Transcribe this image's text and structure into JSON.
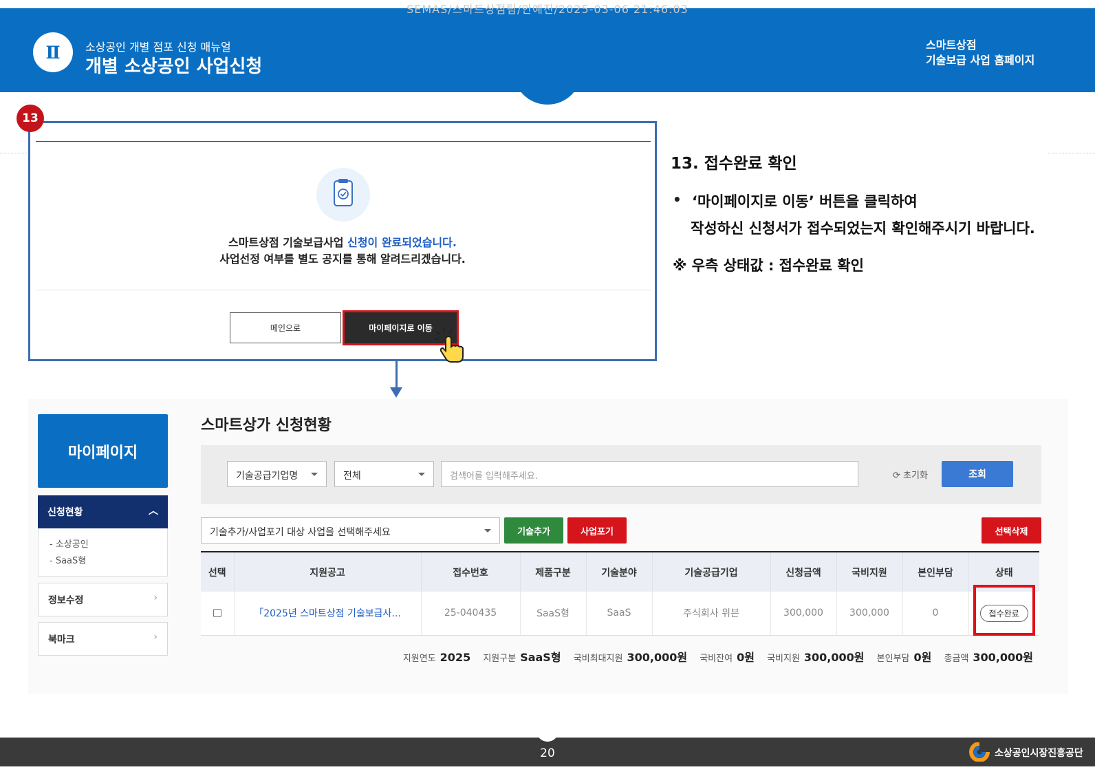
{
  "watermark": "SEMAS/스마트상점팀/안예진/2025-03-06 21:46:03",
  "header": {
    "chapter": "Ⅱ",
    "subtitle": "소상공인 개별 점포 신청 매뉴얼",
    "title": "개별 소상공인 사업신청",
    "right_line1": "스마트상점",
    "right_line2": "기술보급 사업 홈페이지"
  },
  "step_number": "13",
  "modal": {
    "message_line1_prefix": "스마트상점 기술보급사업 ",
    "message_line1_highlight": "신청이 완료되었습니다.",
    "message_line2": "사업선정 여부를 별도 공지를 통해 알려드리겠습니다.",
    "btn_main": "메인으로",
    "btn_mypage": "마이페이지로 이동",
    "icon": "clipboard-check-icon"
  },
  "instructions": {
    "title": "13. 접수완료 확인",
    "bullet": "•",
    "line1": "‘마이페이지로 이동’ 버튼을 클릭하여",
    "line2": "작성하신 신청서가 접수되었는지 확인해주시기 바랍니다.",
    "note": "※ 우측 상태값 : 접수완료 확인"
  },
  "sidebar": {
    "title": "마이페이지",
    "active_menu": "신청현황",
    "sub_items": [
      "- 소상공인",
      "- SaaS형"
    ],
    "items": [
      "정보수정",
      "북마크"
    ]
  },
  "content": {
    "title": "스마트상가 신청현황",
    "filter1": "기술공급기업명",
    "filter2": "전체",
    "search_placeholder": "검색어를 입력해주세요.",
    "reset_label": "초기화",
    "search_button": "조회",
    "action_select": "기술추가/사업포기 대상 사업을 선택해주세요",
    "btn_add_tech": "기술추가",
    "btn_give_up": "사업포기",
    "btn_delete": "선택삭제"
  },
  "table": {
    "headers": [
      "선택",
      "지원공고",
      "접수번호",
      "제품구분",
      "기술분야",
      "기술공급기업",
      "신청금액",
      "국비지원",
      "본인부담",
      "상태"
    ],
    "row": {
      "notice": "「2025년 스마트상점 기술보급사...",
      "receipt_no": "25-040435",
      "product_type": "SaaS형",
      "tech_field": "SaaS",
      "supplier": "주식회사 위븐",
      "apply_amount": "300,000",
      "gov_support": "300,000",
      "self_pay": "0",
      "status": "접수완료"
    }
  },
  "summary": [
    {
      "label": "지원연도",
      "value": "2025"
    },
    {
      "label": "지원구분",
      "value": "SaaS형"
    },
    {
      "label": "국비최대지원",
      "value": "300,000원"
    },
    {
      "label": "국비잔여",
      "value": "0원"
    },
    {
      "label": "국비지원",
      "value": "300,000원"
    },
    {
      "label": "본인부담",
      "value": "0원"
    },
    {
      "label": "총금액",
      "value": "300,000원"
    }
  ],
  "footer": {
    "page_number": "20",
    "org_name": "소상공인시장진흥공단"
  },
  "colors": {
    "brand_blue": "#0a6fc2",
    "highlight_red": "#e0101a",
    "navy": "#12306e"
  }
}
